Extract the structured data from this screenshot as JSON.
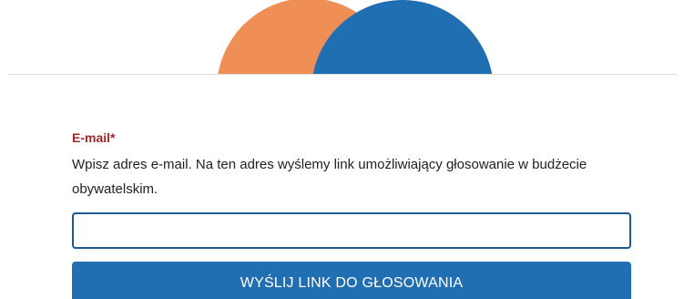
{
  "colors": {
    "logo_orange": "#f08f55",
    "logo_blue": "#1f6fb2",
    "label_red": "#a32626",
    "input_border": "#1c5a8f",
    "button_bg": "#1f6fb2"
  },
  "form": {
    "email_label": "E-mail",
    "required_marker": "*",
    "email_help": "Wpisz adres e-mail. Na ten adres wyślemy link umożliwiający głosowanie w budżecie obywatelskim.",
    "email_value": "",
    "email_placeholder": "",
    "submit_label": "WYŚLIJ LINK DO GŁOSOWANIA"
  }
}
